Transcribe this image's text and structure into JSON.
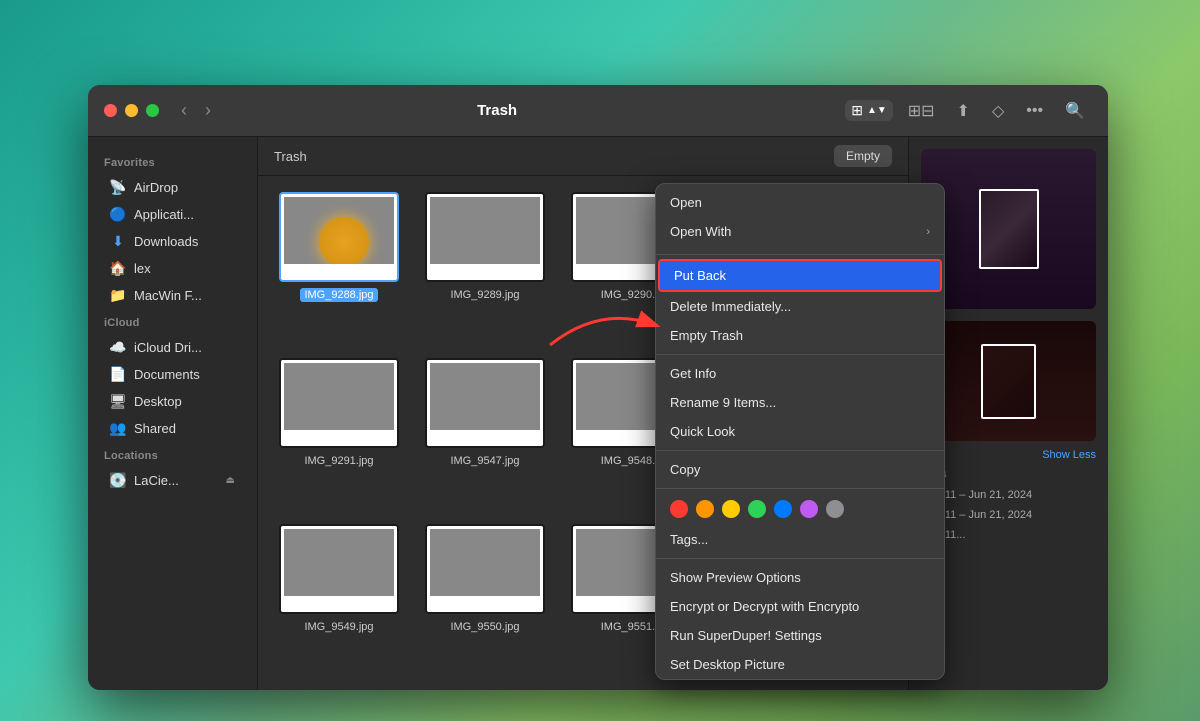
{
  "window": {
    "title": "Trash",
    "location_label": "Trash",
    "empty_btn": "Empty"
  },
  "titlebar": {
    "back_label": "‹",
    "forward_label": "›"
  },
  "sidebar": {
    "favorites_label": "Favorites",
    "icloud_label": "iCloud",
    "locations_label": "Locations",
    "items": [
      {
        "id": "airdrop",
        "label": "AirDrop",
        "icon": "📡"
      },
      {
        "id": "applications",
        "label": "Applicati...",
        "icon": "🔵"
      },
      {
        "id": "downloads",
        "label": "Downloads",
        "icon": "⬇️"
      },
      {
        "id": "lex",
        "label": "lex",
        "icon": "🏠"
      },
      {
        "id": "macwin",
        "label": "MacWin F...",
        "icon": "📁"
      },
      {
        "id": "icloud-drive",
        "label": "iCloud Dri...",
        "icon": "☁️"
      },
      {
        "id": "documents",
        "label": "Documents",
        "icon": "📄"
      },
      {
        "id": "desktop",
        "label": "Desktop",
        "icon": "🖥️"
      },
      {
        "id": "shared",
        "label": "Shared",
        "icon": "👥"
      },
      {
        "id": "lacie",
        "label": "LaCie...",
        "icon": "💽"
      }
    ]
  },
  "files": [
    {
      "name": "IMG_9288.jpg",
      "photo_class": "photo-1",
      "selected": true
    },
    {
      "name": "IMG_9289.jpg",
      "photo_class": "photo-2",
      "selected": false
    },
    {
      "name": "IMG_9290...",
      "photo_class": "photo-3",
      "selected": false
    },
    {
      "name": "IMG_9291.jpg",
      "photo_class": "photo-4",
      "selected": false
    },
    {
      "name": "IMG_9547.jpg",
      "photo_class": "photo-5",
      "selected": false
    },
    {
      "name": "IMG_9548...",
      "photo_class": "photo-6",
      "selected": false
    },
    {
      "name": "IMG_9549.jpg",
      "photo_class": "photo-7",
      "selected": false
    },
    {
      "name": "IMG_9550.jpg",
      "photo_class": "photo-8",
      "selected": false
    },
    {
      "name": "IMG_9551...",
      "photo_class": "photo-9",
      "selected": false
    }
  ],
  "context_menu": {
    "items": [
      {
        "id": "open",
        "label": "Open",
        "shortcut": "",
        "has_arrow": false,
        "divider_before": false
      },
      {
        "id": "open-with",
        "label": "Open With",
        "shortcut": "",
        "has_arrow": true,
        "divider_before": false
      },
      {
        "id": "put-back",
        "label": "Put Back",
        "shortcut": "",
        "has_arrow": false,
        "divider_before": false,
        "highlighted": true
      },
      {
        "id": "delete-immediately",
        "label": "Delete Immediately...",
        "shortcut": "",
        "has_arrow": false,
        "divider_before": false
      },
      {
        "id": "empty-trash",
        "label": "Empty Trash",
        "shortcut": "",
        "has_arrow": false,
        "divider_before": false
      },
      {
        "id": "get-info",
        "label": "Get Info",
        "shortcut": "",
        "has_arrow": false,
        "divider_before": true
      },
      {
        "id": "rename-items",
        "label": "Rename 9 Items...",
        "shortcut": "",
        "has_arrow": false,
        "divider_before": false
      },
      {
        "id": "quick-look",
        "label": "Quick Look",
        "shortcut": "",
        "has_arrow": false,
        "divider_before": false
      },
      {
        "id": "copy",
        "label": "Copy",
        "shortcut": "",
        "has_arrow": false,
        "divider_before": true
      },
      {
        "id": "tags",
        "label": "Tags...",
        "shortcut": "",
        "has_arrow": false,
        "divider_before": true
      },
      {
        "id": "show-preview-options",
        "label": "Show Preview Options",
        "shortcut": "",
        "has_arrow": false,
        "divider_before": true
      },
      {
        "id": "encrypt",
        "label": "Encrypt or Decrypt with Encrypto",
        "shortcut": "",
        "has_arrow": false,
        "divider_before": false
      },
      {
        "id": "superduper",
        "label": "Run SuperDuper! Settings",
        "shortcut": "",
        "has_arrow": false,
        "divider_before": false
      },
      {
        "id": "set-desktop",
        "label": "Set Desktop Picture",
        "shortcut": "",
        "has_arrow": false,
        "divider_before": false
      }
    ],
    "colors": [
      {
        "name": "red",
        "hex": "#ff3a30"
      },
      {
        "name": "orange",
        "hex": "#ff9500"
      },
      {
        "name": "yellow",
        "hex": "#ffcc00"
      },
      {
        "name": "green",
        "hex": "#30d158"
      },
      {
        "name": "blue",
        "hex": "#007aff"
      },
      {
        "name": "purple",
        "hex": "#bf5af2"
      },
      {
        "name": "gray",
        "hex": "#8e8e93"
      }
    ]
  },
  "right_panel": {
    "show_less_label": "Show Less",
    "size_label": "5 MB",
    "dates": [
      "May 11 – Jun 21, 2024",
      "May 11 – Jun 21, 2024",
      "May 11..."
    ]
  }
}
